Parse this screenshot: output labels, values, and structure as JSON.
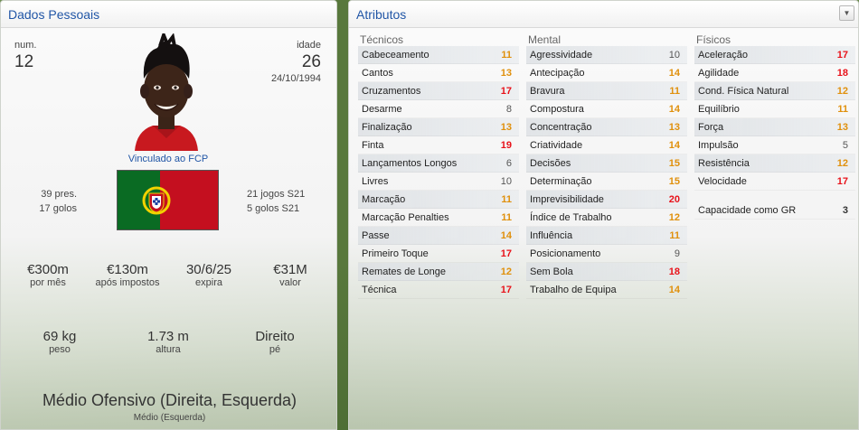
{
  "personal": {
    "title": "Dados Pessoais",
    "num_label": "num.",
    "num": "12",
    "age_label": "idade",
    "age": "26",
    "birthdate": "24/10/1994",
    "loan_text": "Vinculado ao FCP",
    "caps": "39 pres.",
    "goals": "17 golos",
    "u21_caps": "21 jogos S21",
    "u21_goals": "5 golos S21",
    "value1": "€300m",
    "value1_label": "por mês",
    "value2": "€130m",
    "value2_label": "após impostos",
    "value3": "30/6/25",
    "value3_label": "expira",
    "value4": "€31M",
    "value4_label": "valor",
    "weight": "69 kg",
    "weight_label": "peso",
    "height": "1.73 m",
    "height_label": "altura",
    "foot": "Direito",
    "foot_label": "pé",
    "position_main": "Médio Ofensivo (Direita, Esquerda)",
    "position_sub": "Médio (Esquerda)"
  },
  "attributes": {
    "title": "Atributos",
    "tecnicos": {
      "label": "Técnicos",
      "items": [
        {
          "name": "Cabeceamento",
          "value": "11",
          "level": "mid"
        },
        {
          "name": "Cantos",
          "value": "13",
          "level": "mid"
        },
        {
          "name": "Cruzamentos",
          "value": "17",
          "level": "hi"
        },
        {
          "name": "Desarme",
          "value": "8",
          "level": "low"
        },
        {
          "name": "Finalização",
          "value": "13",
          "level": "mid"
        },
        {
          "name": "Finta",
          "value": "19",
          "level": "hi"
        },
        {
          "name": "Lançamentos Longos",
          "value": "6",
          "level": "low"
        },
        {
          "name": "Livres",
          "value": "10",
          "level": "low"
        },
        {
          "name": "Marcação",
          "value": "11",
          "level": "mid"
        },
        {
          "name": "Marcação Penalties",
          "value": "11",
          "level": "mid"
        },
        {
          "name": "Passe",
          "value": "14",
          "level": "mid"
        },
        {
          "name": "Primeiro Toque",
          "value": "17",
          "level": "hi"
        },
        {
          "name": "Remates de Longe",
          "value": "12",
          "level": "mid"
        },
        {
          "name": "Técnica",
          "value": "17",
          "level": "hi"
        }
      ]
    },
    "mental": {
      "label": "Mental",
      "items": [
        {
          "name": "Agressividade",
          "value": "10",
          "level": "low"
        },
        {
          "name": "Antecipação",
          "value": "14",
          "level": "mid"
        },
        {
          "name": "Bravura",
          "value": "11",
          "level": "mid"
        },
        {
          "name": "Compostura",
          "value": "14",
          "level": "mid"
        },
        {
          "name": "Concentração",
          "value": "13",
          "level": "mid"
        },
        {
          "name": "Criatividade",
          "value": "14",
          "level": "mid"
        },
        {
          "name": "Decisões",
          "value": "15",
          "level": "mid"
        },
        {
          "name": "Determinação",
          "value": "15",
          "level": "mid"
        },
        {
          "name": "Imprevisibilidade",
          "value": "20",
          "level": "hi"
        },
        {
          "name": "Índice de Trabalho",
          "value": "12",
          "level": "mid"
        },
        {
          "name": "Influência",
          "value": "11",
          "level": "mid"
        },
        {
          "name": "Posicionamento",
          "value": "9",
          "level": "low"
        },
        {
          "name": "Sem Bola",
          "value": "18",
          "level": "hi"
        },
        {
          "name": "Trabalho de Equipa",
          "value": "14",
          "level": "mid"
        }
      ]
    },
    "fisicos": {
      "label": "Físicos",
      "items": [
        {
          "name": "Aceleração",
          "value": "17",
          "level": "hi"
        },
        {
          "name": "Agilidade",
          "value": "18",
          "level": "hi"
        },
        {
          "name": "Cond. Física Natural",
          "value": "12",
          "level": "mid"
        },
        {
          "name": "Equilíbrio",
          "value": "11",
          "level": "mid"
        },
        {
          "name": "Força",
          "value": "13",
          "level": "mid"
        },
        {
          "name": "Impulsão",
          "value": "5",
          "level": "low"
        },
        {
          "name": "Resistência",
          "value": "12",
          "level": "mid"
        },
        {
          "name": "Velocidade",
          "value": "17",
          "level": "hi"
        }
      ],
      "gk_label": "Capacidade como GR",
      "gk_value": "3"
    }
  },
  "colors": {
    "title_blue": "#2156a6",
    "value_orange": "#e0900c",
    "value_red": "#e8121a",
    "flag_green": "#0a6b23",
    "flag_red": "#c40f1f"
  },
  "icons": [
    "player-portrait",
    "portugal-flag-icon",
    "chevron-down-icon"
  ]
}
